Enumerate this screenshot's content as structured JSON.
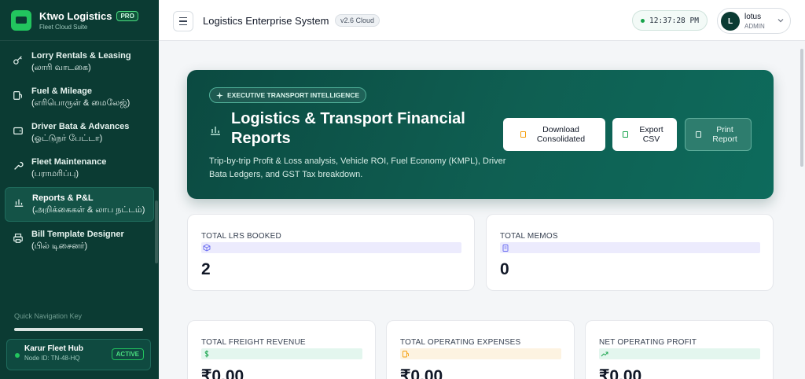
{
  "brand": {
    "title": "Ktwo Logistics",
    "subtitle": "Fleet Cloud Suite",
    "badge": "PRO"
  },
  "sidebar": {
    "items": [
      {
        "en": "Lorry Rentals & Leasing",
        "ta": "(லாரி வாடகை)",
        "icon": "key-icon"
      },
      {
        "en": "Fuel & Mileage",
        "ta": "(எரிபொருள் & மைலேஜ்)",
        "icon": "fuel-icon"
      },
      {
        "en": "Driver Bata & Advances",
        "ta": "(ஓட்டுநர் பேட்டா)",
        "icon": "wallet-icon"
      },
      {
        "en": "Fleet Maintenance",
        "ta": "(பராமரிப்பு)",
        "icon": "wrench-icon"
      },
      {
        "en": "Reports & P&L",
        "ta": "(அறிக்கைகள் & லாப நட்டம்)",
        "icon": "bar-chart-icon",
        "active": true
      },
      {
        "en": "Bill Template Designer",
        "ta": "(பில் டிசைனர்)",
        "icon": "printer-icon"
      }
    ],
    "quick_nav_label": "Quick Navigation Key",
    "hub": {
      "name": "Karur Fleet Hub",
      "node": "Node ID: TN-48-HQ",
      "status": "ACTIVE"
    }
  },
  "header": {
    "title": "Logistics Enterprise System",
    "version": "v2.6 Cloud",
    "clock": "12:37:28 PM",
    "user": {
      "initial": "L",
      "name": "lotus",
      "role": "ADMIN"
    }
  },
  "hero": {
    "tag": "EXECUTIVE TRANSPORT INTELLIGENCE",
    "title": "Logistics & Transport Financial Reports",
    "description": "Trip-by-trip Profit & Loss analysis, Vehicle ROI, Fuel Economy (KMPL), Driver Bata Ledgers, and GST Tax breakdown.",
    "buttons": {
      "download": "Download Consolidated",
      "export": "Export CSV",
      "print": "Print Report"
    }
  },
  "stats": {
    "lrs": {
      "label": "TOTAL LRS BOOKED",
      "value": "2"
    },
    "memos": {
      "label": "TOTAL MEMOS",
      "value": "0"
    },
    "revenue": {
      "label": "TOTAL FREIGHT REVENUE",
      "value": "₹0.00"
    },
    "expenses": {
      "label": "TOTAL OPERATING EXPENSES",
      "value": "₹0.00"
    },
    "profit": {
      "label": "NET OPERATING PROFIT",
      "value": "₹0.00"
    }
  },
  "colors": {
    "sidebar": "#0b3b33",
    "accent": "#22c55e",
    "hero": "#0f5f52"
  }
}
